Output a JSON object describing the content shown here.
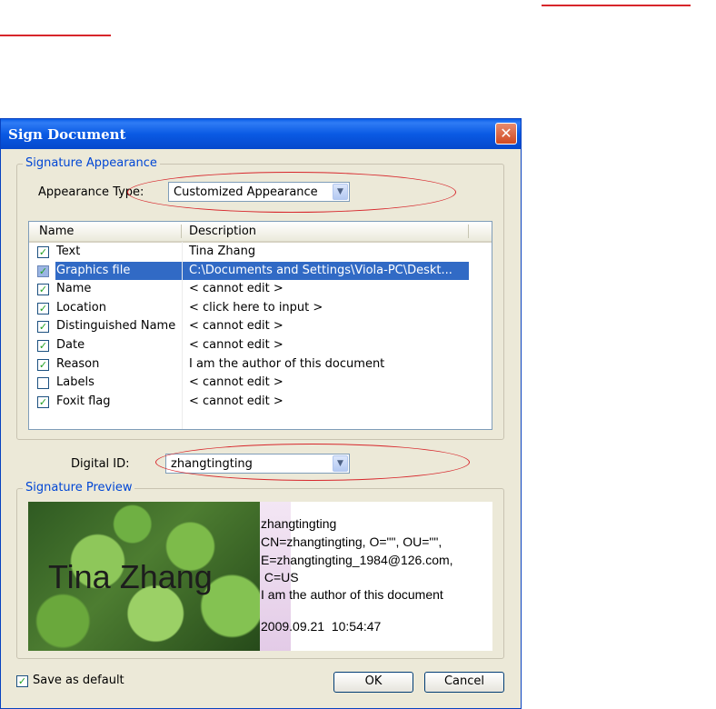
{
  "dialog": {
    "title": "Sign Document",
    "close_glyph": "✕"
  },
  "appearance_group": {
    "legend": "Signature Appearance",
    "type_label": "Appearance Type:",
    "type_value": "Customized Appearance"
  },
  "list": {
    "headers": {
      "name": "Name",
      "description": "Description"
    },
    "rows": [
      {
        "name": "Text",
        "description": "Tina Zhang",
        "checked": true
      },
      {
        "name": "Graphics file",
        "description": "C:\\Documents and Settings\\Viola-PC\\Deskt...",
        "checked": true
      },
      {
        "name": "Name",
        "description": "< cannot edit >",
        "checked": true
      },
      {
        "name": "Location",
        "description": "< click here to input >",
        "checked": true
      },
      {
        "name": "Distinguished Name",
        "description": "< cannot edit >",
        "checked": true
      },
      {
        "name": "Date",
        "description": "< cannot edit >",
        "checked": true
      },
      {
        "name": "Reason",
        "description": "I am the author of this document",
        "checked": true
      },
      {
        "name": "Labels",
        "description": "< cannot edit >",
        "checked": false
      },
      {
        "name": "Foxit flag",
        "description": "< cannot edit >",
        "checked": true
      }
    ],
    "selected_row": "Graphics file"
  },
  "digital_id": {
    "label": "Digital ID:",
    "value": "zhangtingting"
  },
  "preview": {
    "legend": "Signature Preview",
    "image_text": "Tina Zhang",
    "lines": [
      "zhangtingting",
      "CN=zhangtingting, O=\"\", OU=\"\",",
      "E=zhangtingting_1984@126.com,",
      " C=US",
      "I am the author of this document",
      "2009.09.21  10:54:47"
    ]
  },
  "footer": {
    "save_default_label": "Save as default",
    "save_default_checked": true,
    "ok_label": "OK",
    "cancel_label": "Cancel"
  },
  "colors": {
    "annotation": "#d7262b",
    "legend": "#0046d5",
    "selection": "#316ac5"
  },
  "icons": {
    "combo_arrow": "chevron-down-icon",
    "check": "checkmark-icon"
  }
}
